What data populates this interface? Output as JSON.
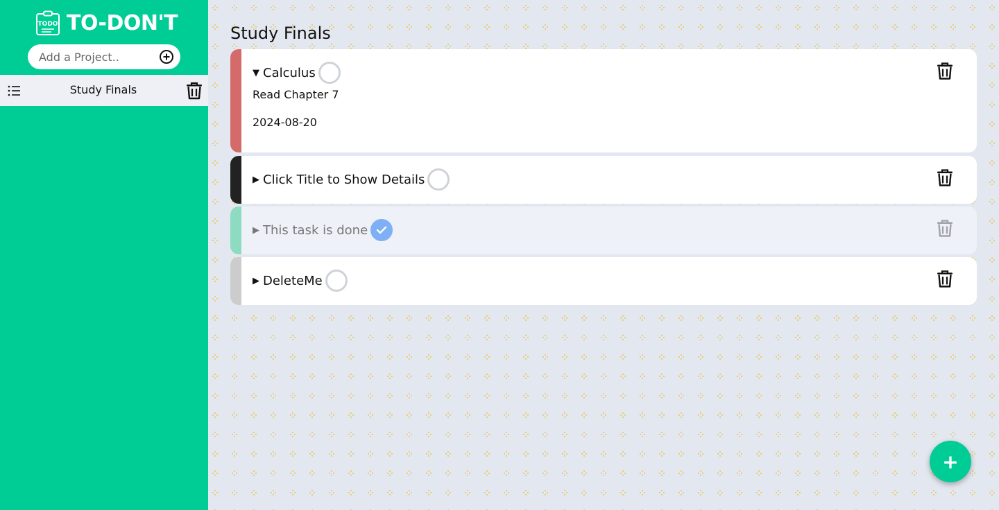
{
  "app": {
    "title": "TO-DON'T",
    "logo_icon_text": "TODO",
    "accent_color": "#00cc96"
  },
  "sidebar": {
    "add_project_placeholder": "Add a Project..",
    "add_project_icon": "plus-circle-icon",
    "projects": [
      {
        "name": "Study Finals",
        "icon": "list-icon",
        "delete_icon": "trash-icon"
      }
    ]
  },
  "main": {
    "project_title": "Study Finals",
    "tasks": [
      {
        "title": "Calculus",
        "expanded": true,
        "done": false,
        "priority_color": "#d46a6a",
        "description": "Read Chapter 7",
        "due_date": "2024-08-20"
      },
      {
        "title": "Click Title to Show Details",
        "expanded": false,
        "done": false,
        "priority_color": "#222222"
      },
      {
        "title": "This task is done",
        "expanded": false,
        "done": true,
        "priority_color": "#8ddbc0"
      },
      {
        "title": "DeleteMe",
        "expanded": false,
        "done": false,
        "priority_color": "#cccccc"
      }
    ],
    "add_task_label": "+"
  }
}
